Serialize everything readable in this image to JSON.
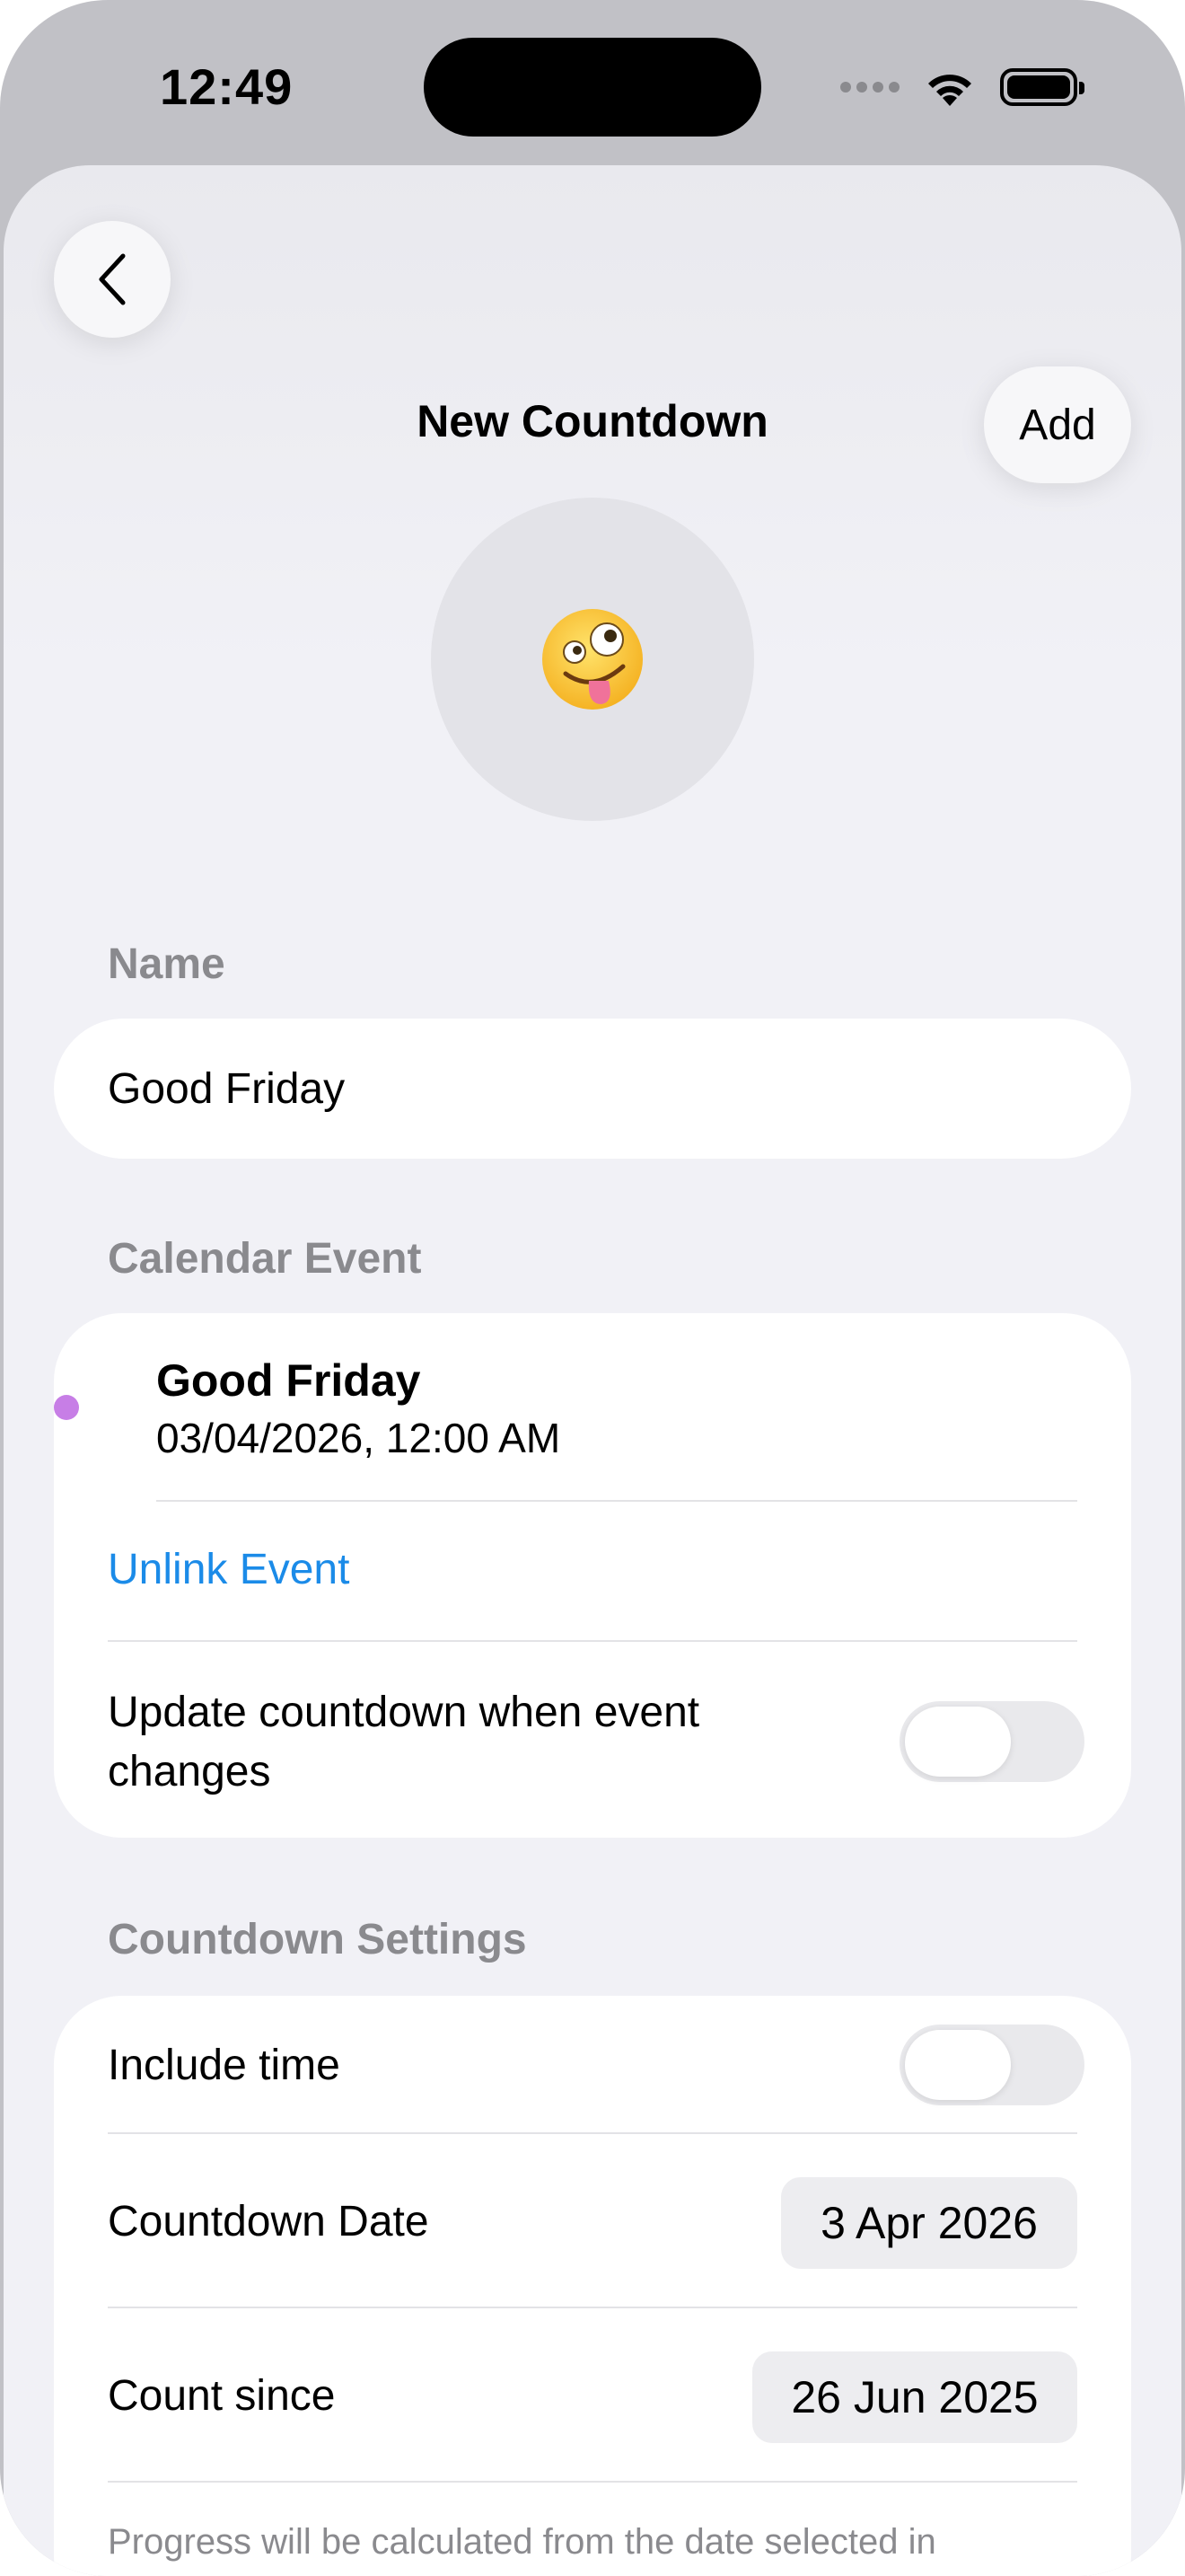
{
  "status_bar": {
    "time": "12:49"
  },
  "header": {
    "title": "New Countdown",
    "add_label": "Add"
  },
  "emoji": {
    "symbol": "🤪",
    "icon": "zany-face-icon"
  },
  "name_section": {
    "label": "Name",
    "value": "Good Friday"
  },
  "calendar_section": {
    "label": "Calendar Event",
    "event_title": "Good Friday",
    "event_datetime": "03/04/2026, 12:00 AM",
    "event_color": "#c77ee6",
    "unlink_label": "Unlink Event",
    "update_label": "Update countdown when event changes",
    "update_enabled": false
  },
  "settings_section": {
    "label": "Countdown Settings",
    "include_time_label": "Include time",
    "include_time_enabled": false,
    "countdown_date_label": "Countdown Date",
    "countdown_date_value": "3 Apr 2026",
    "count_since_label": "Count since",
    "count_since_value": "26 Jun 2025",
    "footnote": "Progress will be calculated from the date selected in"
  },
  "colors": {
    "accent_link": "#1b8be8",
    "label_gray": "#8a8a8e"
  }
}
